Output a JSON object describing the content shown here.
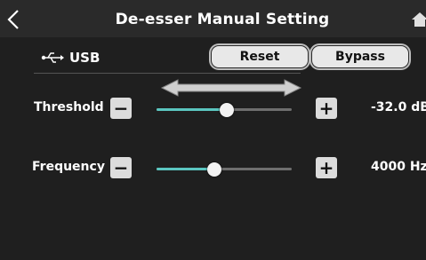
{
  "header": {
    "title": "De-esser Manual Setting"
  },
  "source": {
    "label": "USB",
    "icon": "usb-icon"
  },
  "buttons": {
    "reset_label": "Reset",
    "bypass_label": "Bypass"
  },
  "params": {
    "threshold": {
      "label": "Threshold",
      "value_text": "-32.0 dB",
      "level": 0.52
    },
    "frequency": {
      "label": "Frequency",
      "value_text": "4000 Hz",
      "level": 0.43
    }
  },
  "colors": {
    "accent": "#5bc6c0",
    "background": "#1f1f1f",
    "header": "#2a2a2a",
    "button": "#e8e8e8"
  }
}
